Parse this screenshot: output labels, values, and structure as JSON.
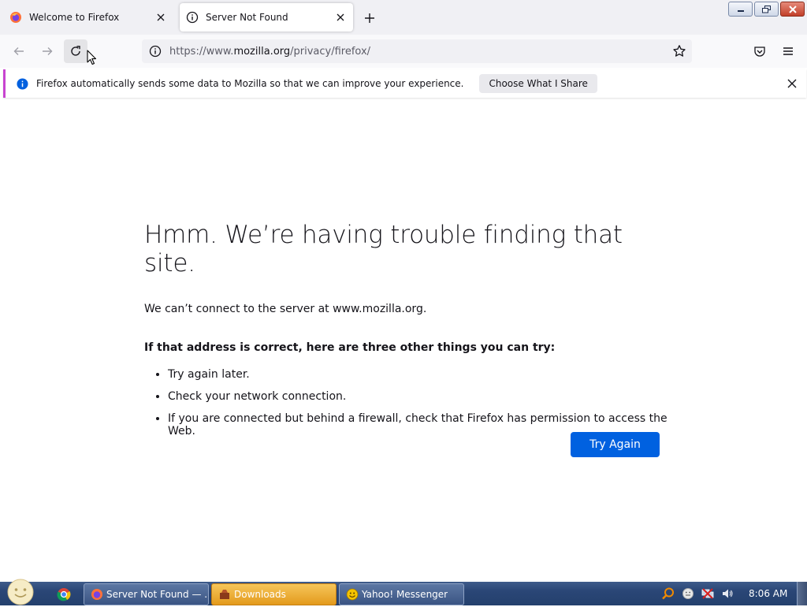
{
  "tabs": [
    {
      "label": "Welcome to Firefox",
      "icon": "firefox-icon",
      "active": false
    },
    {
      "label": "Server Not Found",
      "icon": "info-icon",
      "active": true
    }
  ],
  "navbar": {
    "url_prefix": "https://www.",
    "url_domain": "mozilla.org",
    "url_path": "/privacy/firefox/"
  },
  "notification": {
    "message": "Firefox automatically sends some data to Mozilla so that we can improve your experience.",
    "button_label": "Choose What I Share"
  },
  "error_page": {
    "title": "Hmm. We’re having trouble finding that site.",
    "description": "We can’t connect to the server at www.mozilla.org.",
    "try_heading": "If that address is correct, here are three other things you can try:",
    "suggestions": [
      "Try again later.",
      "Check your network connection.",
      "If you are connected but behind a firewall, check that Firefox has permission to access the Web."
    ],
    "try_again_label": "Try Again"
  },
  "taskbar": {
    "tasks": [
      {
        "label": "Server Not Found — ...",
        "icon": "firefox-icon",
        "active": false
      },
      {
        "label": "Downloads",
        "icon": "downloads-icon",
        "active": true
      },
      {
        "label": "Yahoo! Messenger",
        "icon": "yahoo-messenger-icon",
        "active": false
      }
    ],
    "clock": "8:06 AM"
  },
  "colors": {
    "accent": "#0061e0",
    "notification_border": "#c844d0",
    "taskbar": "#2a4676"
  }
}
